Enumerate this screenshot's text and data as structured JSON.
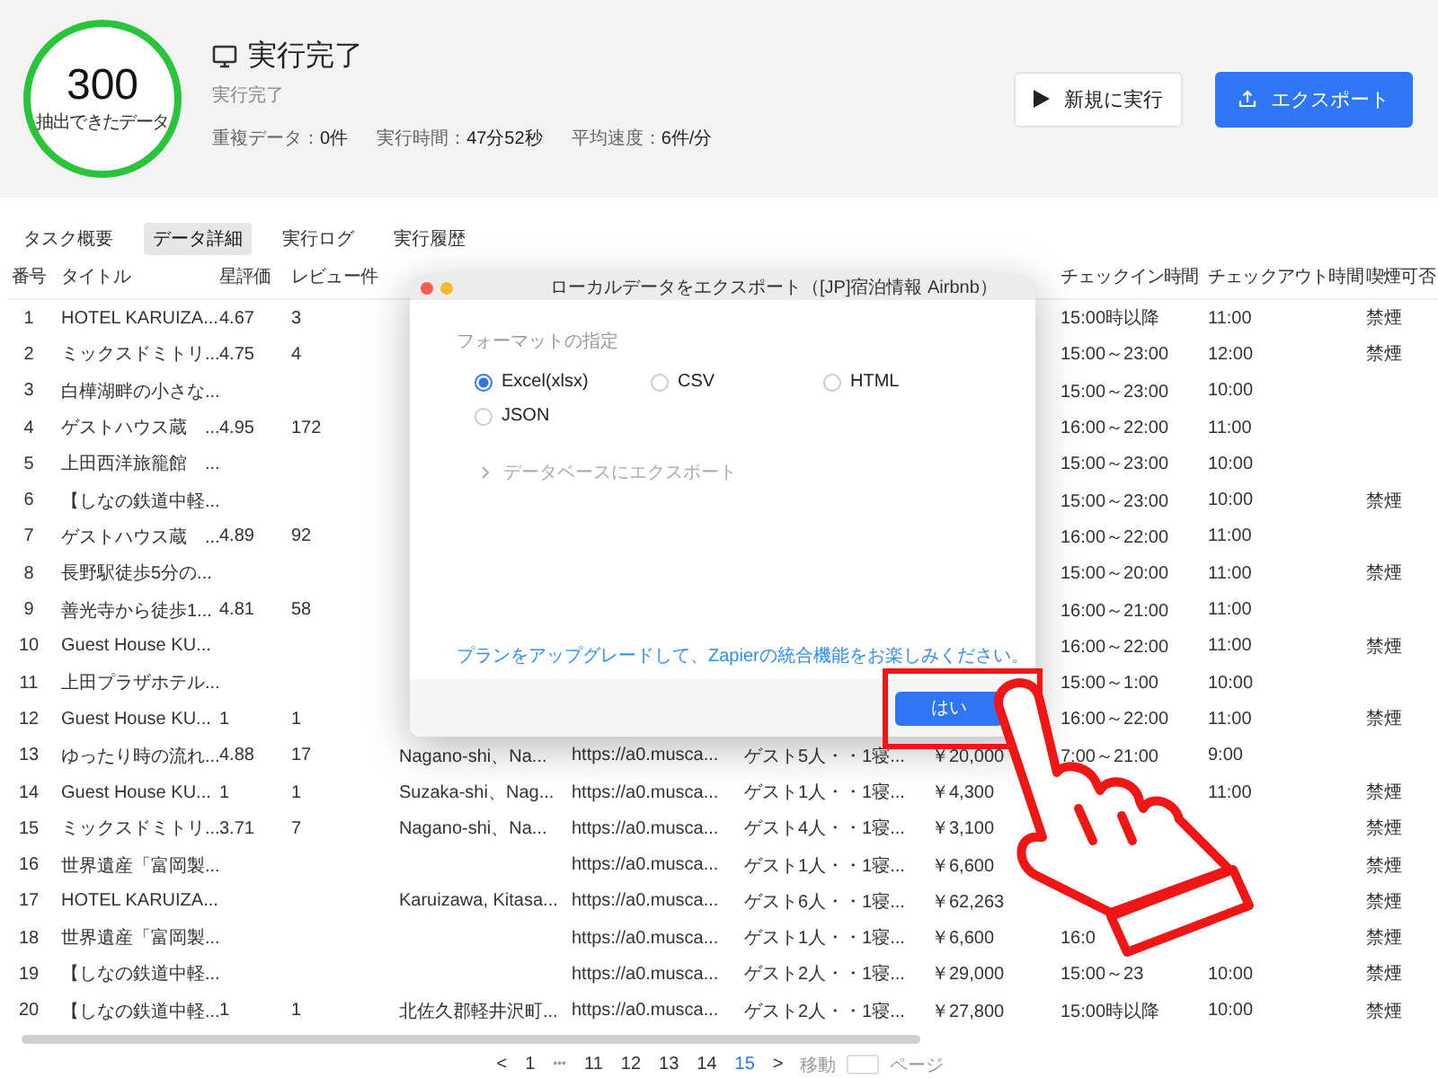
{
  "summary": {
    "count": "300",
    "count_label": "抽出できたデータ",
    "title": "実行完了",
    "subtitle": "実行完了",
    "stats": [
      {
        "label": "重複データ：",
        "value": "0件"
      },
      {
        "label": "実行時間：",
        "value": "47分52秒"
      },
      {
        "label": "平均速度：",
        "value": "6件/分"
      }
    ],
    "buttons": [
      {
        "kind": "run",
        "label": "新規に実行"
      },
      {
        "kind": "export",
        "label": "エクスポート"
      }
    ]
  },
  "tabs": [
    {
      "label": "タスク概要",
      "selected": false
    },
    {
      "label": "データ詳細",
      "selected": true
    },
    {
      "label": "実行ログ",
      "selected": false
    },
    {
      "label": "実行履歴",
      "selected": false
    }
  ],
  "table": {
    "columns": [
      "番号",
      "タイトル",
      "星評価",
      "レビュー件",
      null,
      null,
      null,
      null,
      "チェックイン時間",
      "チェックアウト時間",
      "喫煙可否"
    ],
    "rows": [
      {
        "cells": [
          "1",
          "HOTEL KARUIZA...",
          "4.67",
          "3",
          null,
          null,
          null,
          null,
          "15:00時以降",
          "11:00",
          "禁煙"
        ]
      },
      {
        "cells": [
          "2",
          "ミックスドミトリ...",
          "4.75",
          "4",
          null,
          null,
          null,
          null,
          "15:00～23:00",
          "12:00",
          "禁煙"
        ]
      },
      {
        "cells": [
          "3",
          "白樺湖畔の小さな...",
          null,
          null,
          null,
          null,
          null,
          null,
          "15:00～23:00",
          "10:00",
          null
        ]
      },
      {
        "cells": [
          "4",
          "ゲストハウス蔵　...",
          "4.95",
          "172",
          null,
          null,
          null,
          null,
          "16:00～22:00",
          "11:00",
          null
        ]
      },
      {
        "cells": [
          "5",
          "上田西洋旅籠館　...",
          null,
          null,
          null,
          null,
          null,
          null,
          "15:00～23:00",
          "10:00",
          null
        ]
      },
      {
        "cells": [
          "6",
          "【しなの鉄道中軽...",
          null,
          null,
          null,
          null,
          null,
          null,
          "15:00～23:00",
          "10:00",
          "禁煙"
        ]
      },
      {
        "cells": [
          "7",
          "ゲストハウス蔵　...",
          "4.89",
          "92",
          null,
          null,
          null,
          null,
          "16:00～22:00",
          "11:00",
          null
        ]
      },
      {
        "cells": [
          "8",
          "長野駅徒歩5分の...",
          null,
          null,
          null,
          null,
          null,
          null,
          "15:00～20:00",
          "11:00",
          "禁煙"
        ]
      },
      {
        "cells": [
          "9",
          "善光寺から徒歩1...",
          "4.81",
          "58",
          null,
          null,
          null,
          null,
          "16:00～21:00",
          "11:00",
          null
        ]
      },
      {
        "cells": [
          "10",
          "Guest House KU...",
          null,
          null,
          null,
          null,
          null,
          null,
          "16:00～22:00",
          "11:00",
          "禁煙"
        ]
      },
      {
        "cells": [
          "11",
          "上田プラザホテル...",
          null,
          null,
          null,
          null,
          null,
          null,
          "15:00～1:00",
          "10:00",
          null
        ]
      },
      {
        "cells": [
          "12",
          "Guest House KU...",
          "1",
          "1",
          null,
          null,
          null,
          null,
          "16:00～22:00",
          "11:00",
          "禁煙"
        ]
      },
      {
        "cells": [
          "13",
          "ゆったり時の流れ...",
          "4.88",
          "17",
          "Nagano-shi、Na...",
          "https://a0.musca...",
          "ゲスト5人・・1寝...",
          "￥20,000",
          "7:00～21:00",
          "9:00",
          null
        ]
      },
      {
        "cells": [
          "14",
          "Guest House KU...",
          "1",
          "1",
          "Suzaka-shi、Nag...",
          "https://a0.musca...",
          "ゲスト1人・・1寝...",
          "￥4,300",
          null,
          "11:00",
          "禁煙"
        ]
      },
      {
        "cells": [
          "15",
          "ミックスドミトリ...",
          "3.71",
          "7",
          "Nagano-shi、Na...",
          "https://a0.musca...",
          "ゲスト4人・・1寝...",
          "￥3,100",
          null,
          null,
          "禁煙"
        ]
      },
      {
        "cells": [
          "16",
          "世界遺産「富岡製...",
          null,
          null,
          null,
          "https://a0.musca...",
          "ゲスト1人・・1寝...",
          "￥6,600",
          null,
          null,
          "禁煙"
        ]
      },
      {
        "cells": [
          "17",
          "HOTEL KARUIZA...",
          null,
          null,
          "Karuizawa, Kitasa...",
          "https://a0.musca...",
          "ゲスト6人・・1寝...",
          "￥62,263",
          null,
          null,
          "禁煙"
        ]
      },
      {
        "cells": [
          "18",
          "世界遺産「富岡製...",
          null,
          null,
          null,
          "https://a0.musca...",
          "ゲスト1人・・1寝...",
          "￥6,600",
          "16:0",
          null,
          "禁煙"
        ]
      },
      {
        "cells": [
          "19",
          "【しなの鉄道中軽...",
          null,
          null,
          null,
          "https://a0.musca...",
          "ゲスト2人・・1寝...",
          "￥29,000",
          "15:00～23",
          "10:00",
          "禁煙"
        ]
      },
      {
        "cells": [
          "20",
          "【しなの鉄道中軽...",
          "1",
          "1",
          "北佐久郡軽井沢町...",
          "https://a0.musca...",
          "ゲスト2人・・1寝...",
          "￥27,800",
          "15:00時以降",
          "10:00",
          "禁煙"
        ]
      }
    ]
  },
  "pagination": {
    "items": [
      {
        "kind": "prev",
        "label": "<"
      },
      {
        "kind": "page",
        "label": "1",
        "selected": false
      },
      {
        "kind": "ellipsis",
        "label": "•••"
      },
      {
        "kind": "page",
        "label": "11",
        "selected": false
      },
      {
        "kind": "page",
        "label": "12",
        "selected": false
      },
      {
        "kind": "page",
        "label": "13",
        "selected": false
      },
      {
        "kind": "page",
        "label": "14",
        "selected": false
      },
      {
        "kind": "page",
        "label": "15",
        "selected": true
      },
      {
        "kind": "next",
        "label": ">"
      }
    ],
    "jump_label": "移動",
    "jump_suffix": "ページ"
  },
  "dialog": {
    "title": "ローカルデータをエクスポート（[JP]宿泊情報 Airbnb）",
    "section_label": "フォーマットの指定",
    "formats": [
      {
        "label": "Excel(xlsx)",
        "selected": true
      },
      {
        "label": "CSV",
        "selected": false
      },
      {
        "label": "HTML",
        "selected": false
      },
      {
        "label": "JSON",
        "selected": false
      }
    ],
    "database_export": {
      "label": "データベースにエクスポート",
      "expanded": false
    },
    "upgrade_link": "プランをアップグレードして、Zapierの統合機能をお楽しみください。",
    "confirm_button": "はい"
  }
}
